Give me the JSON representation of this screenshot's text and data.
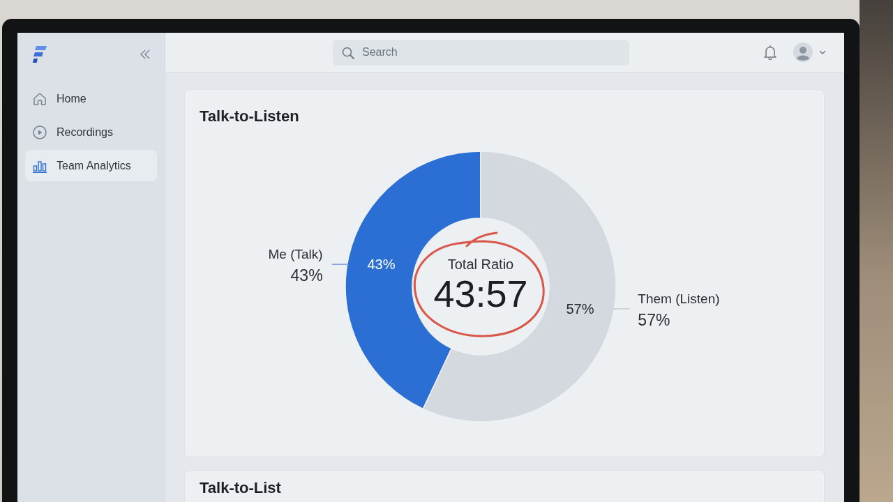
{
  "sidebar": {
    "items": [
      {
        "label": "Home",
        "selected": false
      },
      {
        "label": "Recordings",
        "selected": false
      },
      {
        "label": "Team Analytics",
        "selected": true
      }
    ]
  },
  "top_bar": {
    "search": {
      "placeholder": "Search"
    }
  },
  "cards": [
    {
      "title": "Talk-to-Listen",
      "chart_data": {
        "type": "donut",
        "categories": [
          "Me (Talk)",
          "Them (Listen)"
        ],
        "values": [
          43,
          57
        ],
        "value_labels": [
          "43%",
          "57%"
        ]
      },
      "callout_values": [
        "43%",
        "57%"
      ],
      "center": {
        "caption": "Total Ratio",
        "value": "43:57",
        "circled": true
      }
    },
    {
      "title": "Talk-to-List"
    }
  ]
}
